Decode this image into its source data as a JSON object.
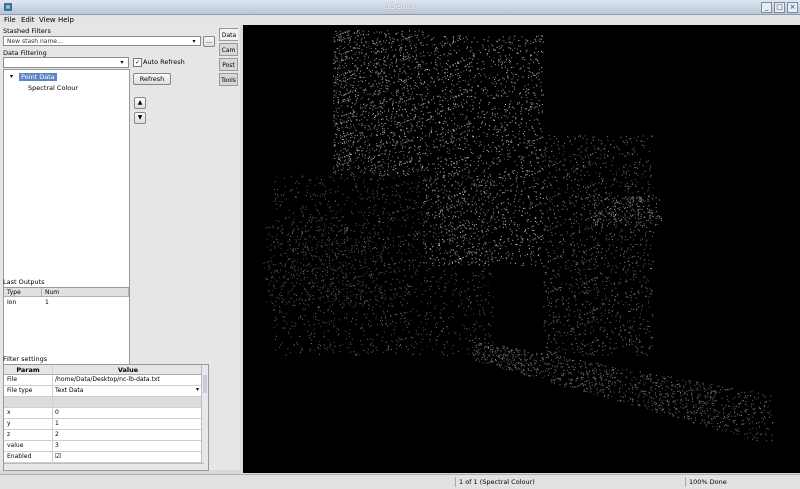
{
  "window": {
    "title": "3Depict"
  },
  "menu": {
    "file": "File",
    "edit": "Edit",
    "view": "View",
    "help": "Help"
  },
  "stash": {
    "label": "Stashed Filters",
    "placeholder": "New stash name...",
    "dots": "..."
  },
  "filtering": {
    "label": "Data Filtering",
    "auto_refresh": "Auto Refresh",
    "refresh_button": "Refresh",
    "up": "▲",
    "down": "▼",
    "tree": {
      "root": "Point Data",
      "child": "Spectral Colour"
    }
  },
  "outputs": {
    "label": "Last Outputs",
    "columns": [
      "Type",
      "Num"
    ],
    "rows": [
      {
        "type": "Ion",
        "num": "1"
      }
    ]
  },
  "filter_settings": {
    "label": "Filter settings",
    "columns": [
      "Param",
      "Value"
    ],
    "rows": [
      {
        "param": "File",
        "value": "/home/Data/Desktop/nc-lb-data.txt"
      },
      {
        "param": "File type",
        "value": "Text Data"
      },
      {
        "param": "",
        "value": ""
      },
      {
        "param": "x",
        "value": "0"
      },
      {
        "param": "y",
        "value": "1"
      },
      {
        "param": "z",
        "value": "2"
      },
      {
        "param": "value",
        "value": "3"
      },
      {
        "param": "Enabled",
        "value": ""
      }
    ]
  },
  "tabs": [
    "Data",
    "Cam",
    "Post",
    "Tools"
  ],
  "status": {
    "left": "",
    "middle": "1 of 1 (Spectral Colour)",
    "right": "100% Done"
  },
  "colors": {
    "viewport_bg": "#000000",
    "selection": "#5b86c5"
  }
}
